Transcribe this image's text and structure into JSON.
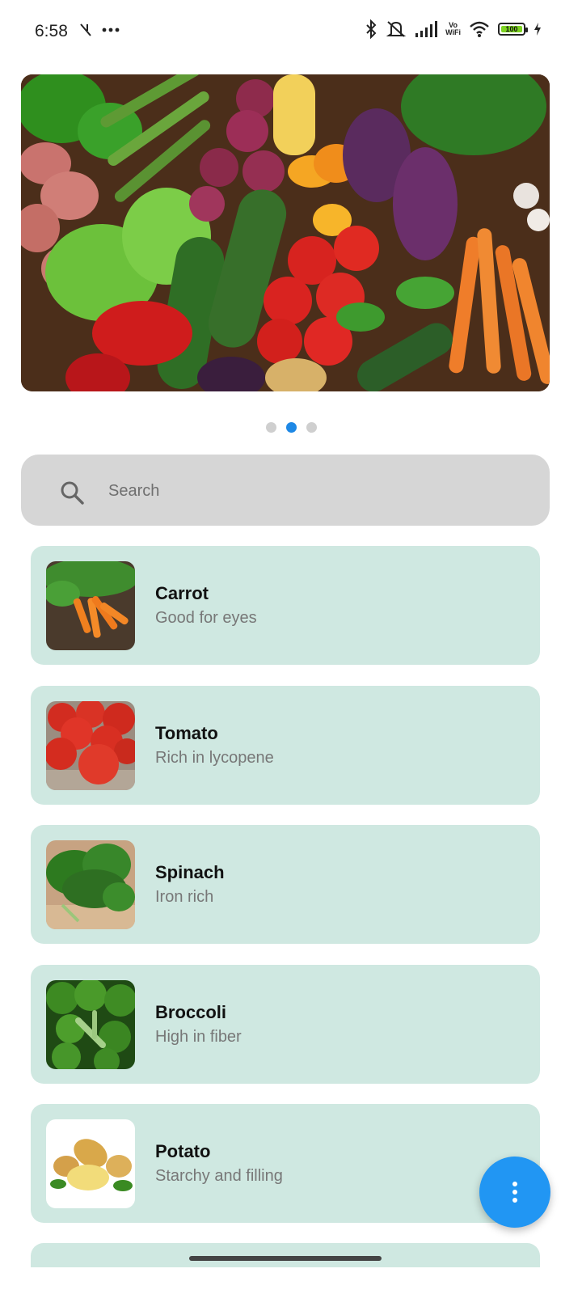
{
  "status_bar": {
    "time": "6:58",
    "battery_level": "100",
    "network_label_top": "Vo",
    "network_label_bottom": "WiFi",
    "icons": [
      "signal-slash-icon",
      "more-dots-icon",
      "bluetooth-icon",
      "mute-icon",
      "cellular-signal-icon",
      "wifi-icon",
      "battery-icon",
      "charging-icon"
    ]
  },
  "carousel": {
    "image": "vegetable-assortment",
    "active_index": 1,
    "count": 3
  },
  "search": {
    "placeholder": "Search"
  },
  "items": [
    {
      "name": "Carrot",
      "description": "Good for eyes",
      "image": "carrot-photo"
    },
    {
      "name": "Tomato",
      "description": "Rich in lycopene",
      "image": "tomato-photo"
    },
    {
      "name": "Spinach",
      "description": "Iron rich",
      "image": "spinach-photo"
    },
    {
      "name": "Broccoli",
      "description": "High in fiber",
      "image": "broccoli-photo"
    },
    {
      "name": "Potato",
      "description": "Starchy and filling",
      "image": "potato-photo"
    }
  ],
  "fab": {
    "icon": "more-vert-icon"
  },
  "colors": {
    "card_bg": "#cfe8e1",
    "search_bg": "#d6d6d6",
    "accent": "#2196f3",
    "dot_active": "#1e88e5"
  }
}
